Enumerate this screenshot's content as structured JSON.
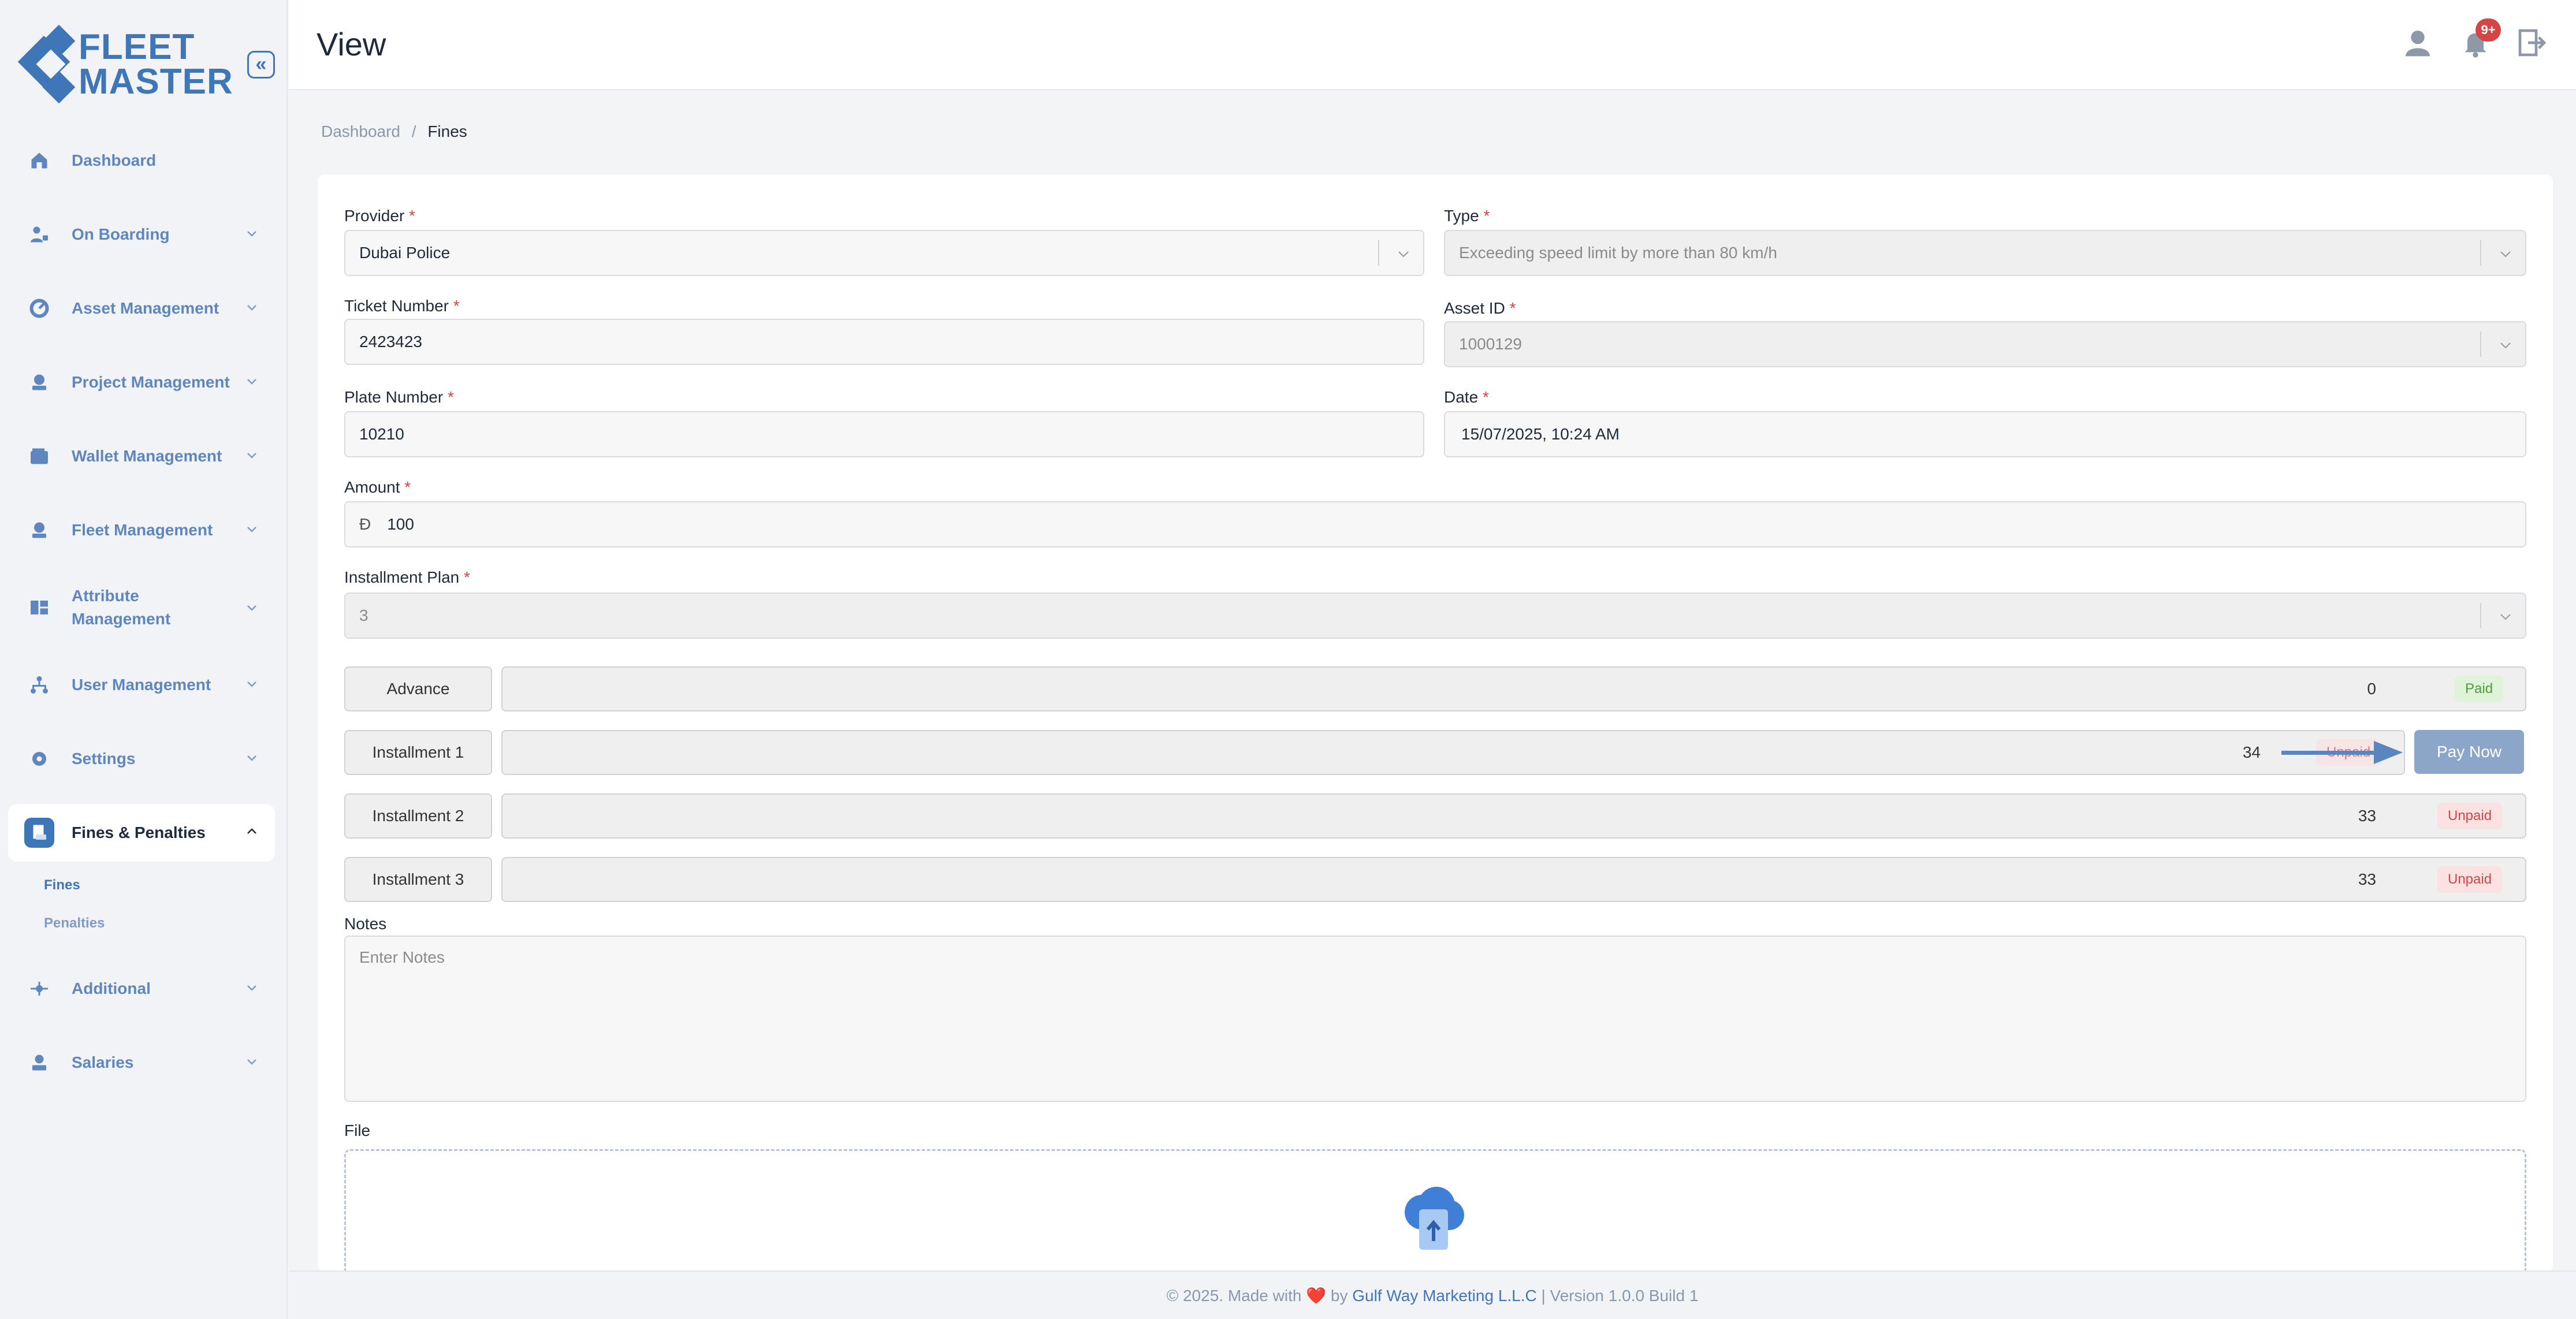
{
  "header": {
    "title": "View",
    "notification_count": "9+"
  },
  "logo": {
    "line1": "FLEET",
    "line2": "MASTER"
  },
  "sidebar": {
    "items": [
      {
        "label": "Dashboard"
      },
      {
        "label": "On Boarding"
      },
      {
        "label": "Asset Management"
      },
      {
        "label": "Project Management"
      },
      {
        "label": "Wallet Management"
      },
      {
        "label": "Fleet Management"
      },
      {
        "label": "Attribute Management"
      },
      {
        "label": "User Management"
      },
      {
        "label": "Settings"
      },
      {
        "label": "Fines & Penalties"
      },
      {
        "label": "Additional"
      },
      {
        "label": "Salaries"
      }
    ],
    "sub_items": [
      {
        "label": "Fines"
      },
      {
        "label": "Penalties"
      }
    ]
  },
  "breadcrumb": {
    "root": "Dashboard",
    "separator": "/",
    "current": "Fines"
  },
  "form": {
    "provider": {
      "label": "Provider",
      "value": "Dubai Police"
    },
    "type": {
      "label": "Type",
      "value": "Exceeding speed limit by more than 80 km/h"
    },
    "ticket_number": {
      "label": "Ticket Number",
      "value": "2423423"
    },
    "asset_id": {
      "label": "Asset ID",
      "value": "1000129"
    },
    "plate_number": {
      "label": "Plate Number",
      "value": "10210"
    },
    "date": {
      "label": "Date",
      "value": "15/07/2025, 10:24 AM"
    },
    "amount": {
      "label": "Amount",
      "currency_symbol": "Đ",
      "value": "100"
    },
    "installment_plan": {
      "label": "Installment Plan",
      "value": "3"
    },
    "required_mark": "*",
    "installments": [
      {
        "label": "Advance",
        "amount": "0",
        "status": "Paid"
      },
      {
        "label": "Installment 1",
        "amount": "34",
        "status": "Unpaid"
      },
      {
        "label": "Installment 2",
        "amount": "33",
        "status": "Unpaid"
      },
      {
        "label": "Installment 3",
        "amount": "33",
        "status": "Unpaid"
      }
    ],
    "pay_now_label": "Pay Now",
    "notes": {
      "label": "Notes",
      "placeholder": "Enter Notes"
    },
    "file": {
      "label": "File"
    }
  },
  "footer": {
    "prefix": "© 2025. Made with",
    "heart": "❤️",
    "by": "by",
    "company": "Gulf Way Marketing L.L.C",
    "version": "| Version 1.0.0 Build 1"
  },
  "colors": {
    "accent": "#3f76b8",
    "paid": "#4e9a3c",
    "unpaid": "#d64545"
  }
}
